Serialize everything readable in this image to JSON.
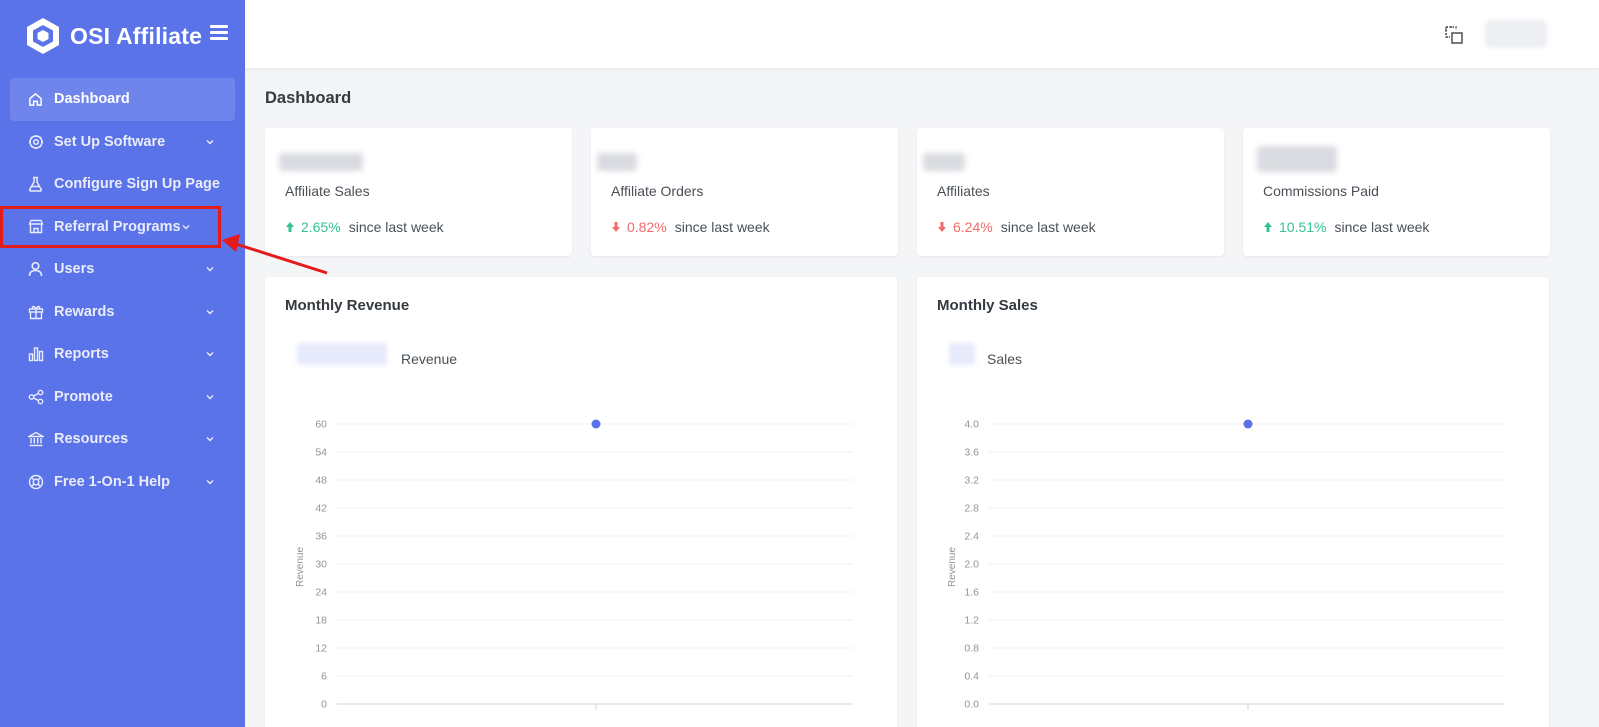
{
  "app": {
    "brand_name": "OSI Affiliate",
    "colors": {
      "sidebar": "#5b73e8",
      "up": "#34c38f",
      "down": "#f46a6a",
      "annotation": "#e31b1b"
    }
  },
  "sidebar": {
    "items": [
      {
        "label": "Dashboard",
        "icon": "home-icon",
        "active": true,
        "has_chevron": false
      },
      {
        "label": "Set Up Software",
        "icon": "gear-icon",
        "has_chevron": true
      },
      {
        "label": "Configure Sign Up Page",
        "icon": "flask-icon",
        "has_chevron": false
      },
      {
        "label": "Referral Programs",
        "icon": "store-icon",
        "has_chevron": true,
        "highlighted": true
      },
      {
        "label": "Users",
        "icon": "user-icon",
        "has_chevron": true
      },
      {
        "label": "Rewards",
        "icon": "gift-icon",
        "has_chevron": true
      },
      {
        "label": "Reports",
        "icon": "bar-chart-icon",
        "has_chevron": true
      },
      {
        "label": "Promote",
        "icon": "share-icon",
        "has_chevron": true
      },
      {
        "label": "Resources",
        "icon": "bank-icon",
        "has_chevron": true
      },
      {
        "label": "Free 1-On-1 Help",
        "icon": "lifebuoy-icon",
        "has_chevron": true
      }
    ]
  },
  "main": {
    "page_title": "Dashboard",
    "stats": [
      {
        "label": "Affiliate Sales",
        "change": "2.65%",
        "direction": "up",
        "suffix": "since last week"
      },
      {
        "label": "Affiliate Orders",
        "change": "0.82%",
        "direction": "down",
        "suffix": "since last week"
      },
      {
        "label": "Affiliates",
        "change": "6.24%",
        "direction": "down",
        "suffix": "since last week"
      },
      {
        "label": "Commissions Paid",
        "change": "10.51%",
        "direction": "up",
        "suffix": "since last week"
      }
    ],
    "charts": [
      {
        "title": "Monthly Revenue",
        "legend_label": "Revenue"
      },
      {
        "title": "Monthly Sales",
        "legend_label": "Sales"
      }
    ]
  },
  "chart_data": [
    {
      "type": "line",
      "title": "Monthly Revenue",
      "ylabel": "Revenue",
      "ylim": [
        0,
        60
      ],
      "yticks": [
        "60",
        "54",
        "48",
        "42",
        "36",
        "30",
        "24",
        "18",
        "12",
        "6",
        "0"
      ],
      "grid": true,
      "series": [
        {
          "name": "Revenue",
          "values": [
            60
          ]
        }
      ],
      "color": "#5b73e8"
    },
    {
      "type": "line",
      "title": "Monthly Sales",
      "ylabel": "Revenue",
      "ylim": [
        0,
        4.0
      ],
      "yticks": [
        "4.0",
        "3.6",
        "3.2",
        "2.8",
        "2.4",
        "2.0",
        "1.6",
        "1.2",
        "0.8",
        "0.4",
        "0.0"
      ],
      "grid": true,
      "series": [
        {
          "name": "Sales",
          "values": [
            4.0
          ]
        }
      ],
      "color": "#5b73e8"
    }
  ]
}
